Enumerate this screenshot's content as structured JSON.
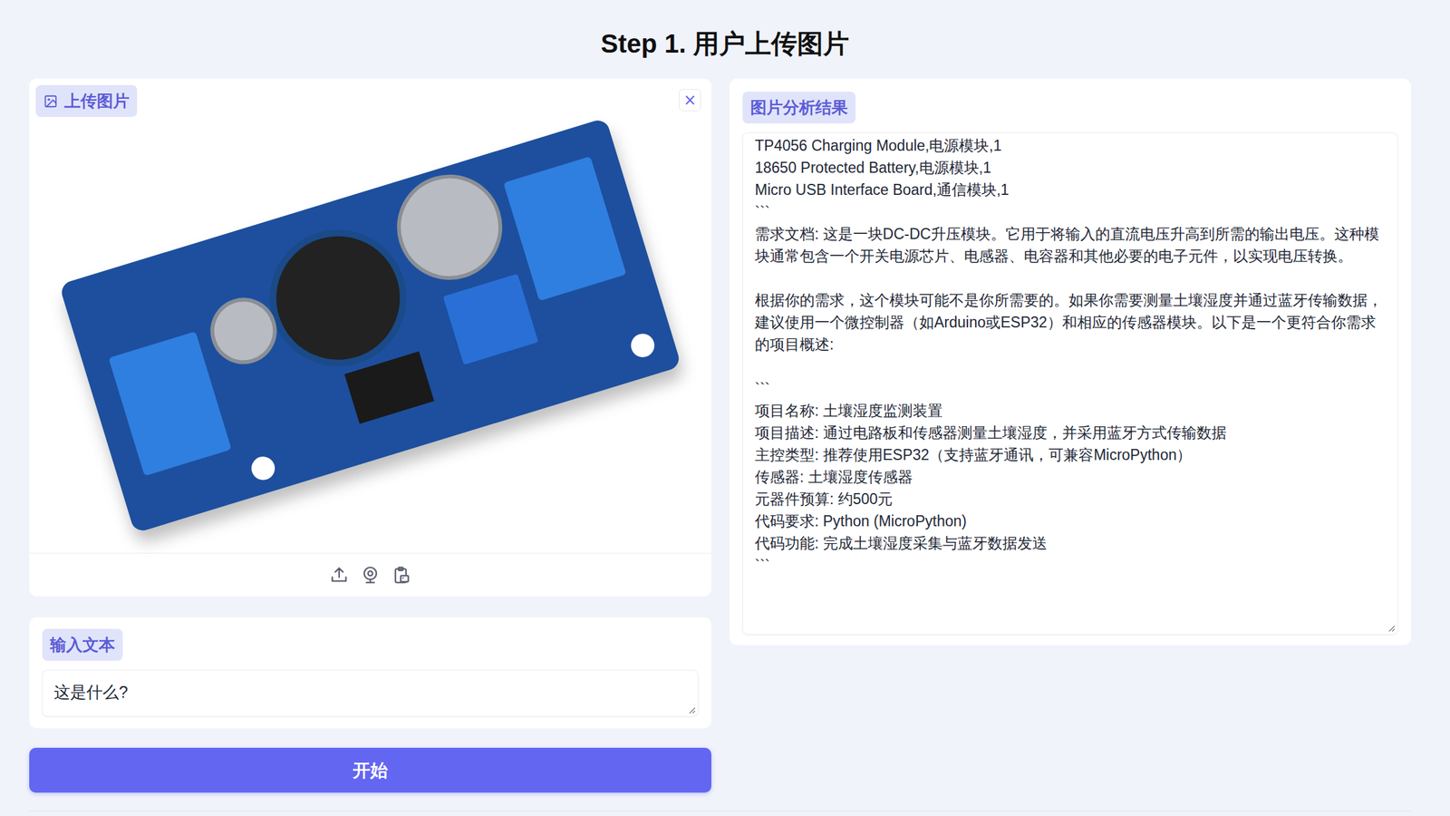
{
  "page": {
    "title": "Step 1. 用户上传图片"
  },
  "upload_panel": {
    "label": "上传图片",
    "close": "×"
  },
  "input_panel": {
    "label": "输入文本",
    "value": "这是什么?"
  },
  "start_button": {
    "label": "开始"
  },
  "result_panel": {
    "label": "图片分析结果",
    "lines": [
      "TP4056 Charging Module,电源模块,1",
      "18650 Protected Battery,电源模块,1",
      "Micro USB Interface Board,通信模块,1",
      "```",
      "需求文档: 这是一块DC-DC升压模块。它用于将输入的直流电压升高到所需的输出电压。这种模块通常包含一个开关电源芯片、电感器、电容器和其他必要的电子元件，以实现电压转换。",
      "",
      "根据你的需求，这个模块可能不是你所需要的。如果你需要测量土壤湿度并通过蓝牙传输数据，建议使用一个微控制器（如Arduino或ESP32）和相应的传感器模块。以下是一个更符合你需求的项目概述:",
      "",
      "```",
      "项目名称: 土壤湿度监测装置",
      "项目描述: 通过电路板和传感器测量土壤湿度，并采用蓝牙方式传输数据",
      "主控类型: 推荐使用ESP32（支持蓝牙通讯，可兼容MicroPython）",
      "传感器: 土壤湿度传感器",
      "元器件预算: 约500元",
      "代码要求: Python (MicroPython)",
      "代码功能: 完成土壤湿度采集与蓝牙数据发送",
      "```"
    ]
  }
}
